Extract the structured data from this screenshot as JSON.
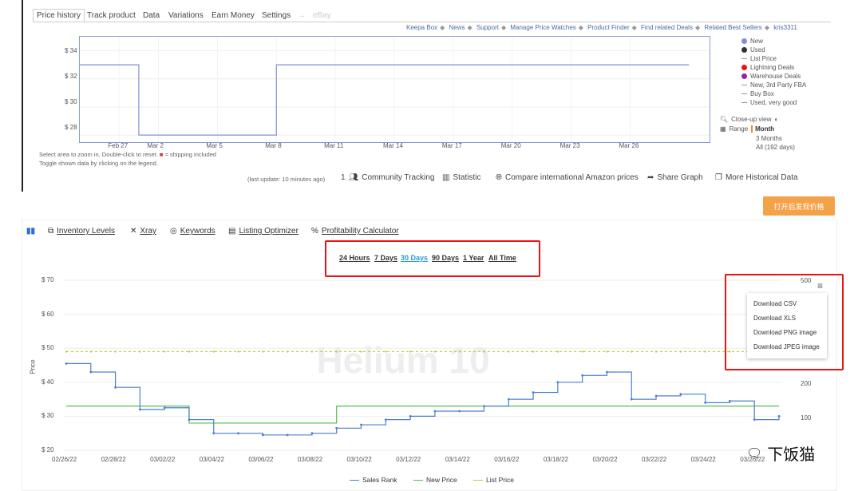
{
  "keepa": {
    "tabs": [
      "Price history",
      "Track product",
      "Data",
      "Variations",
      "Earn Money",
      "Settings",
      "eBay"
    ],
    "links": [
      "Keepa Box",
      "News",
      "Support",
      "Manage Price Watches",
      "Product Finder",
      "Find related Deals",
      "Related Best Sellers",
      "kris3311"
    ],
    "y_labels": [
      "$ 34",
      "$ 32",
      "$ 30",
      "$ 28"
    ],
    "x_labels": [
      "Feb 27",
      "Mar 2",
      "Mar 5",
      "Mar 8",
      "Mar 11",
      "Mar 14",
      "Mar 17",
      "Mar 20",
      "Mar 23",
      "Mar 26"
    ],
    "legend": [
      {
        "label": "New",
        "marker": "dot",
        "color": "#8888dd"
      },
      {
        "label": "Used",
        "marker": "dot",
        "color": "#333333"
      },
      {
        "label": "List Price",
        "marker": "dash",
        "color": "#999999"
      },
      {
        "label": "Lightning Deals",
        "marker": "dot",
        "color": "#ee1111"
      },
      {
        "label": "Warehouse Deals",
        "marker": "dot",
        "color": "#9922aa"
      },
      {
        "label": "New, 3rd Party FBA",
        "marker": "dash",
        "color": "#999999"
      },
      {
        "label": "Buy Box",
        "marker": "dash",
        "color": "#999999"
      },
      {
        "label": "Used, very good",
        "marker": "dash",
        "color": "#999999"
      }
    ],
    "closeup_label": "Close-up view",
    "range_label": "Range",
    "range_options": [
      "Month",
      "3 Months",
      "All (192 days)"
    ],
    "note1": "Select area to zoom in. Double-click to reset.",
    "note1b": "= shipping included",
    "note2": "Toggle shown data by clicking on the legend.",
    "last_update": "(last update: 10 minutes ago)",
    "tools": {
      "tracking_count": "1",
      "tracking": "Community Tracking",
      "statistic": "Statistic",
      "compare": "Compare international Amazon prices",
      "share": "Share Graph",
      "historical": "More Historical Data"
    },
    "chart_data": {
      "type": "line",
      "title": "",
      "y_tick_labels": [
        "$ 34",
        "$ 32",
        "$ 30",
        "$ 28"
      ],
      "ylim": [
        27.5,
        35
      ],
      "x_tick_labels": [
        "Feb 27",
        "Mar 2",
        "Mar 5",
        "Mar 8",
        "Mar 11",
        "Mar 14",
        "Mar 17",
        "Mar 20",
        "Mar 23",
        "Mar 26"
      ],
      "series": [
        {
          "name": "New",
          "x": [
            "Feb 25",
            "Mar 1",
            "Mar 1",
            "Mar 8",
            "Mar 8",
            "Mar 29"
          ],
          "y": [
            33,
            33,
            28,
            28,
            33,
            33
          ]
        }
      ]
    }
  },
  "helium": {
    "orange_button": "打开后发现价格",
    "tools": [
      "Inventory Levels",
      "Xray",
      "Keywords",
      "Listing Optimizer",
      "Profitability Calculator"
    ],
    "time_ranges": [
      "24 Hours",
      "7 Days",
      "30 Days",
      "90 Days",
      "1 Year",
      "All Time"
    ],
    "active_range": "30 Days",
    "y_left": [
      "$ 70",
      "$ 60",
      "$ 50",
      "$ 40",
      "$ 30",
      "$ 20"
    ],
    "y_right": [
      "500",
      "200",
      "100"
    ],
    "y_axis_title": "Price",
    "watermark": "Helium 10",
    "x_labels": [
      "02/26/22",
      "02/28/22",
      "03/02/22",
      "03/04/22",
      "03/06/22",
      "03/08/22",
      "03/10/22",
      "03/12/22",
      "03/14/22",
      "03/16/22",
      "03/18/22",
      "03/20/22",
      "03/22/22",
      "03/24/22",
      "03/26/22"
    ],
    "menu": [
      "Download CSV",
      "Download XLS",
      "Download PNG image",
      "Download JPEG image"
    ],
    "legend": [
      {
        "label": "Sales Rank",
        "color": "#4a7fd0"
      },
      {
        "label": "New Price",
        "color": "#55bb55"
      },
      {
        "label": "List Price",
        "color": "#c8c83a"
      }
    ],
    "watermark_cn": "下饭猫",
    "chart_data": {
      "type": "line",
      "x": [
        "02/26/22",
        "02/27/22",
        "02/28/22",
        "03/01/22",
        "03/02/22",
        "03/03/22",
        "03/04/22",
        "03/05/22",
        "03/06/22",
        "03/07/22",
        "03/08/22",
        "03/09/22",
        "03/10/22",
        "03/11/22",
        "03/12/22",
        "03/13/22",
        "03/14/22",
        "03/15/22",
        "03/16/22",
        "03/17/22",
        "03/18/22",
        "03/19/22",
        "03/20/22",
        "03/21/22",
        "03/22/22",
        "03/23/22",
        "03/24/22",
        "03/25/22",
        "03/26/22"
      ],
      "ylim_left": [
        20,
        70
      ],
      "series": [
        {
          "name": "Sales Rank",
          "values": [
            45.5,
            43,
            38.5,
            32,
            32.5,
            29,
            25,
            25,
            24.5,
            24.5,
            25,
            26.5,
            27.5,
            29,
            30,
            31.5,
            31.5,
            33,
            35,
            37,
            40,
            42,
            43,
            35,
            36,
            36.5,
            34,
            34.5,
            29,
            30
          ]
        },
        {
          "name": "New Price",
          "values": [
            33,
            33,
            33,
            33,
            33,
            28,
            28,
            28,
            28,
            28,
            28,
            33,
            33,
            33,
            33,
            33,
            33,
            33,
            33,
            33,
            33,
            33,
            33,
            33,
            33,
            33,
            33,
            33,
            33,
            33
          ]
        },
        {
          "name": "List Price",
          "values": [
            49,
            49,
            49,
            49,
            49,
            49,
            49,
            49,
            49,
            49,
            49,
            49,
            49,
            49,
            49,
            49,
            49,
            49,
            49,
            49,
            49,
            49,
            49,
            49,
            49,
            49,
            49,
            49,
            49,
            49
          ]
        }
      ]
    }
  }
}
